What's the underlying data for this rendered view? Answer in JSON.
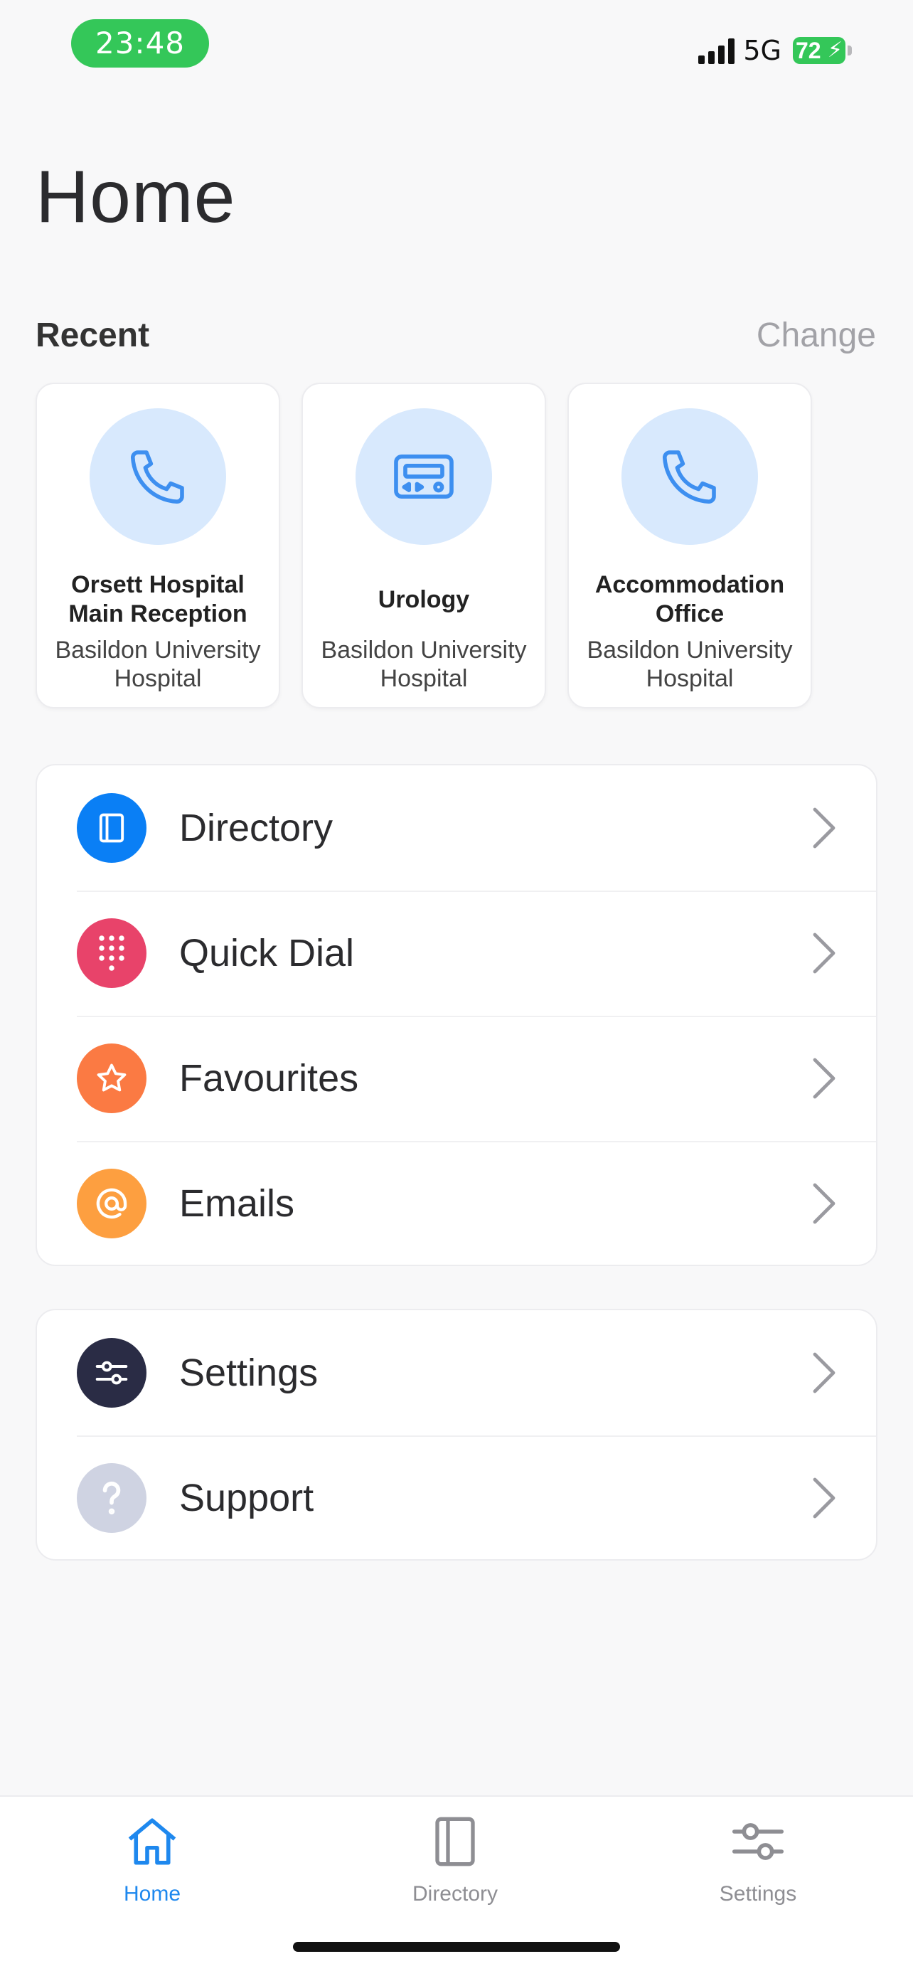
{
  "status": {
    "time": "23:48",
    "network": "5G",
    "battery": "72"
  },
  "page": {
    "title": "Home"
  },
  "recent": {
    "label": "Recent",
    "change_label": "Change",
    "items": [
      {
        "name": "Orsett Hospital Main Reception",
        "place": "Basildon University Hospital",
        "icon": "phone-icon"
      },
      {
        "name": "Urology",
        "place": "Basildon University Hospital",
        "icon": "pager-icon"
      },
      {
        "name": "Accommodation Office",
        "place": "Basildon University Hospital",
        "icon": "phone-icon"
      }
    ]
  },
  "menu": {
    "main": [
      {
        "label": "Directory",
        "icon": "book-icon",
        "color": "#0a7ff5"
      },
      {
        "label": "Quick Dial",
        "icon": "keypad-icon",
        "color": "#e8436a"
      },
      {
        "label": "Favourites",
        "icon": "star-icon",
        "color": "#fb7a43"
      },
      {
        "label": "Emails",
        "icon": "at-icon",
        "color": "#fd9f40"
      }
    ],
    "secondary": [
      {
        "label": "Settings",
        "icon": "sliders-icon",
        "color": "#2a2c45"
      },
      {
        "label": "Support",
        "icon": "question-icon",
        "color": "#cfd3e2"
      }
    ]
  },
  "tabs": [
    {
      "label": "Home",
      "icon": "home-icon",
      "active": true
    },
    {
      "label": "Directory",
      "icon": "book-icon",
      "active": false
    },
    {
      "label": "Settings",
      "icon": "sliders-icon",
      "active": false
    }
  ],
  "colors": {
    "accent": "#1e88ee",
    "status_green": "#34c759",
    "recent_circle": "#d8e9fd"
  }
}
